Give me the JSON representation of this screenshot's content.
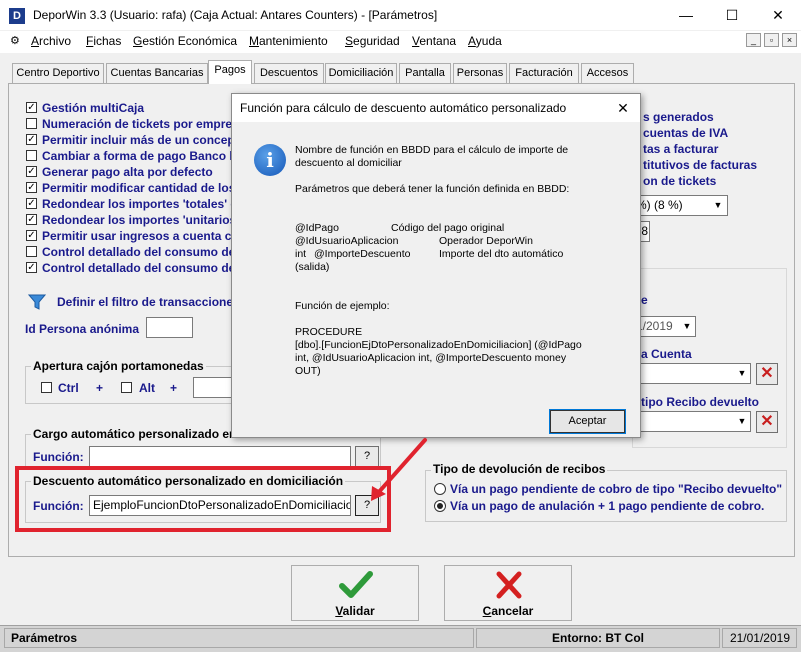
{
  "window": {
    "app_icon_letter": "D",
    "title": "DeporWin 3.3  (Usuario: rafa)  (Caja Actual: Antares Counters) - [Parámetros]",
    "minimize": "—",
    "maximize": "☐",
    "close": "✕"
  },
  "menu": {
    "items": [
      {
        "key": "A",
        "rest": "rchivo"
      },
      {
        "key": "F",
        "rest": "ichas"
      },
      {
        "key": "G",
        "rest": "estión Económica"
      },
      {
        "key": "M",
        "rest": "antenimiento"
      },
      {
        "key": "S",
        "rest": "eguridad"
      },
      {
        "key": "V",
        "rest": "entana"
      },
      {
        "key": "A",
        "rest": "yuda"
      }
    ],
    "mdi_min": "_",
    "mdi_restore": "▫",
    "mdi_close": "×"
  },
  "tabs": [
    "Centro Deportivo",
    "Cuentas Bancarias",
    "Pagos",
    "Descuentos",
    "Domiciliación",
    "Pantalla",
    "Personas",
    "Facturación",
    "Accesos"
  ],
  "active_tab": "Pagos",
  "pagos": {
    "checkboxes": [
      {
        "label": "Gestión multiCaja",
        "checked": true
      },
      {
        "label": "Numeración de tickets por empre",
        "checked": false
      },
      {
        "label": "Permitir incluir más de un concep",
        "checked": true
      },
      {
        "label": "Cambiar a forma de pago Banco l",
        "checked": false
      },
      {
        "label": "Generar pago alta por defecto",
        "checked": true
      },
      {
        "label": "Permitir modificar cantidad de los",
        "checked": true
      },
      {
        "label": "Redondear los importes 'totales' c",
        "checked": true
      },
      {
        "label": "Redondear los importes 'unitarios",
        "checked": true
      },
      {
        "label": "Permitir usar ingresos a cuenta c",
        "checked": true
      },
      {
        "label": "Control detallado del consumo de",
        "checked": false
      },
      {
        "label": "Control detallado del consumo de",
        "checked": true
      }
    ],
    "filter_link": "Definir el filtro de transaccione",
    "id_persona_label": "Id Persona anónima",
    "id_persona_value": "",
    "cajon": {
      "title": "Apertura cajón portamonedas",
      "ctrl": "Ctrl",
      "plus1": "+",
      "alt": "Alt",
      "plus2": "+"
    },
    "cargo": {
      "title": "Cargo automático personalizado en",
      "funcion_label": "Función:",
      "funcion_value": "",
      "btn": "?"
    },
    "descuento": {
      "title": "Descuento automático personalizado en domiciliación",
      "funcion_label": "Función:",
      "funcion_value": "EjemploFuncionDtoPersonalizadoEnDomiciliacion",
      "btn": "?"
    },
    "right_options": [
      "s generados",
      "cuentas de IVA",
      "tas a facturar",
      "titutivos de facturas",
      "on de tickets"
    ],
    "iva_combo": "%) (8 %)",
    "iva_extra": "8",
    "e_label": "e",
    "date_combo": "1/2019",
    "cuenta_label": "a Cuenta",
    "recibo_label": "tipo Recibo devuelto",
    "devolucion": {
      "title": "Tipo de devolución de recibos",
      "option1": "Vía un pago pendiente de cobro de tipo \"Recibo devuelto\"",
      "option2": "Vía un pago de anulación  + 1 pago pendiente de cobro.",
      "selected": 2
    }
  },
  "buttons": {
    "validar": {
      "key": "V",
      "rest": "alidar"
    },
    "cancelar": {
      "key": "C",
      "rest": "ancelar"
    }
  },
  "statusbar": {
    "left": "Parámetros",
    "entorno": "Entorno: BT Col",
    "date": "21/01/2019"
  },
  "dialog": {
    "title": "Función para cálculo de descuento automático personalizado",
    "close": "✕",
    "icon_letter": "i",
    "line1": "Nombre de función en BBDD para el cálculo de importe de",
    "line2": "descuento al domiciliar",
    "params_title": "Parámetros que deberá tener la función definida en BBDD:",
    "params": [
      {
        "name": "@IdPago",
        "desc": "Código del pago original"
      },
      {
        "name": "@IdUsuarioAplicacion",
        "desc": "Operador DeporWin"
      },
      {
        "name": "@ImporteDescuento",
        "desc": "Importe del dto automático"
      }
    ],
    "params_type1": "int",
    "params_type2": "int",
    "params_salida": "(salida)",
    "example_title": "Función de ejemplo:",
    "example_lines": [
      "PROCEDURE",
      "[dbo].[FuncionEjDtoPersonalizadoEnDomiciliacion] (@IdPago",
      "int, @IdUsuarioAplicacion int, @ImporteDescuento money",
      "OUT)"
    ],
    "accept": "Aceptar"
  },
  "colors": {
    "highlight": "#e0232e",
    "label_blue": "#1a1a8c",
    "validar_check": "#2e9a3a",
    "cancel_x": "#d42020"
  }
}
